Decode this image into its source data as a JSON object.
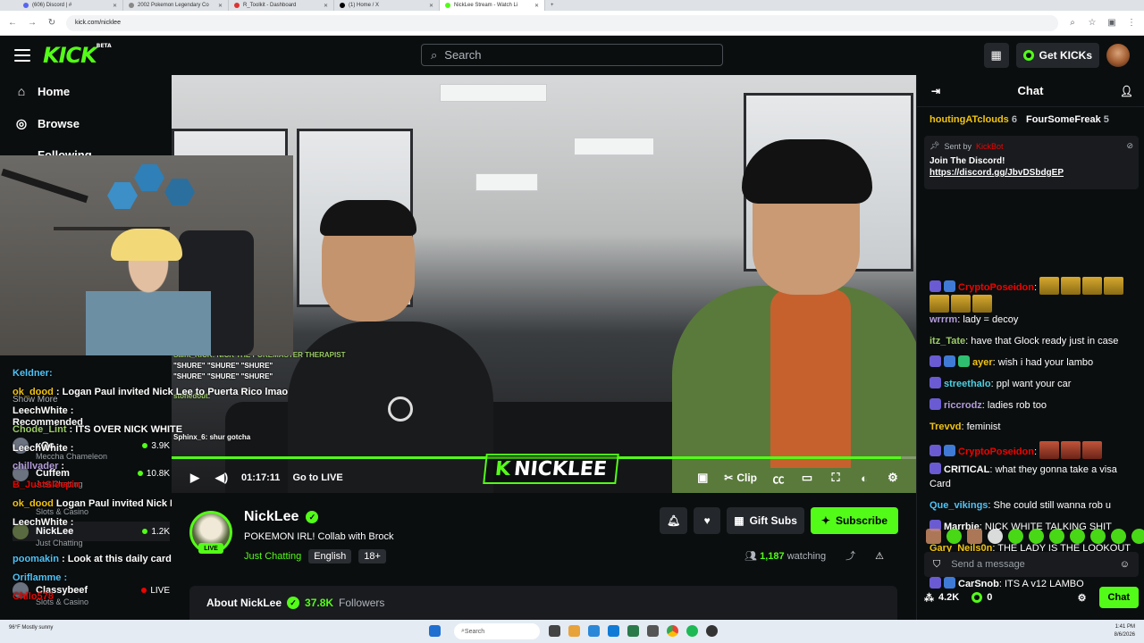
{
  "browser": {
    "tabs": [
      {
        "title": "(606) Discord | #"
      },
      {
        "title": "2002 Pokemon Legendary Co"
      },
      {
        "title": "R_Toolkit - Dashboard"
      },
      {
        "title": "(1) Home / X"
      },
      {
        "title": "NickLee Stream - Watch Li"
      }
    ],
    "url": "kick.com/nicklee",
    "new_tab": "+"
  },
  "header": {
    "logo": "KICK",
    "logo_badge": "BETA",
    "search_placeholder": "Search",
    "get_kicks": "Get KICKs"
  },
  "sidebar": {
    "items": [
      {
        "label": "Home",
        "icon": "home-icon"
      },
      {
        "label": "Browse",
        "icon": "compass-icon"
      }
    ],
    "following": "Following",
    "streams": [
      {
        "name": "xQc",
        "category": "Meccha Chameleon",
        "viewers": "3.9K"
      },
      {
        "name": "Cuffem",
        "category": "Just Chatting",
        "viewers": "10.8K"
      },
      {
        "name": "ClinesDrogas",
        "category": "Slots & Casino",
        "viewers": ""
      },
      {
        "name": "NickLee",
        "category": "Just Chatting",
        "viewers": "1.2K"
      },
      {
        "name": "Classybeef",
        "category": "Slots & Casino",
        "viewers": "LIVE"
      }
    ],
    "show_more": "Show More",
    "recommended": "Recommended"
  },
  "overlay_chat": [
    {
      "user": "Keldner",
      "text": ":"
    },
    {
      "user": "ok_dood",
      "text": "Logan Paul invited Nick Lee to Puerta Rico lmao"
    },
    {
      "user": "LeechWhite",
      "text": ":"
    },
    {
      "user": "Chode_Lint",
      "text": "ITS OVER NICK WHITE"
    },
    {
      "user": "LeechWhite",
      "text": ":"
    },
    {
      "user": "chillvader",
      "text": ":"
    },
    {
      "user": "B_JustSleepin",
      "text": ""
    },
    {
      "user": "ok_dood",
      "text": "Logan Paul invited Nick Lee to Puerta Rico lmao"
    },
    {
      "user": "LeechWhite",
      "text": ":"
    },
    {
      "user": "poomakin",
      "text": "Look at this daily card I just collected"
    },
    {
      "user": "Oriflamme",
      "text": ":"
    },
    {
      "user": "Chilo578",
      "text": ""
    }
  ],
  "video": {
    "time": "01:17:11",
    "go_live": "Go to LIVE",
    "clip": "Clip",
    "watermark": "NICKLEE",
    "progress_pct": 98,
    "embedded_chat": [
      "Saint_KICK: NICK THE POKEMASTER THERAPIST",
      "\"SHURE\" \"SHURE\" \"SHURE\"",
      "stonedout:",
      "Sphinx_6: shur gotcha"
    ]
  },
  "stream": {
    "name": "NickLee",
    "live": "LIVE",
    "title": "POKEMON IRL!  Collab with Brock",
    "category": "Just Chatting",
    "tags": [
      "English",
      "18+"
    ],
    "gift_subs": "Gift Subs",
    "subscribe": "Subscribe",
    "viewers": "1,187",
    "watching": "watching",
    "about": "About NickLee",
    "followers_count": "37.8K",
    "followers_label": "Followers"
  },
  "chat": {
    "title": "Chat",
    "gifters": [
      {
        "name": "houtingATclouds",
        "count": "6"
      },
      {
        "name": "FourSomeFreak",
        "count": "5"
      }
    ],
    "pinned": {
      "sent_by": "Sent by",
      "bot": "KickBot",
      "title": "Join The Discord!",
      "link": "https://discord.gg/JbvDSbdgEP"
    },
    "messages": [
      {
        "user": "CryptoPoseidon",
        "color": "#eb0400",
        "text": "",
        "badges": 2,
        "emotes": 7,
        "emote_style": "gold"
      },
      {
        "user": "wrrrm",
        "color": "#b39ddb",
        "text": "lady = decoy",
        "badges": 0
      },
      {
        "user": "itz_Tate",
        "color": "#9ccc65",
        "text": "have that Glock ready just in case",
        "badges": 0
      },
      {
        "user": "ayer",
        "color": "#f1c40f",
        "text": "wish i had your lambo",
        "badges": 3
      },
      {
        "user": "streethalo",
        "color": "#4dd0e1",
        "text": "ppl want your car",
        "badges": 1
      },
      {
        "user": "riccrodz",
        "color": "#b39ddb",
        "text": "ladies rob too",
        "badges": 1
      },
      {
        "user": "Trevvd",
        "color": "#f1c40f",
        "text": "feminist",
        "badges": 0
      },
      {
        "user": "CryptoPoseidon",
        "color": "#eb0400",
        "text": "",
        "badges": 2,
        "emotes": 3,
        "emote_style": "red"
      },
      {
        "user": "CRITICAL",
        "color": "#fff",
        "text": "what they gonna take a visa Card",
        "badges": 1
      },
      {
        "user": "Que_vikings",
        "color": "#4fc3f7",
        "text": "She could still wanna rob u",
        "badges": 0
      },
      {
        "user": "Marrbie",
        "color": "#fff",
        "text": "NICK WHITE TALKING SHIT",
        "badges": 1
      },
      {
        "user": "Gary_Neils0n",
        "color": "#f1c40f",
        "text": "THE LADY IS THE LOOKOUT AND SPOTTER",
        "badges": 0
      },
      {
        "user": "CarSnob",
        "color": "#fff",
        "text": "ITS A v12 LAMBO",
        "badges": 2
      }
    ],
    "input_placeholder": "Send a message",
    "kicks_count": "4.2K",
    "points": "0",
    "send": "Chat"
  },
  "taskbar": {
    "search": "Search",
    "weather": "96°F Mostly sunny",
    "time": "1:41 PM",
    "date": "8/6/2026"
  },
  "colors": {
    "accent": "#53fc18",
    "bg": "#0b0e0f",
    "panel": "#191b1f"
  }
}
